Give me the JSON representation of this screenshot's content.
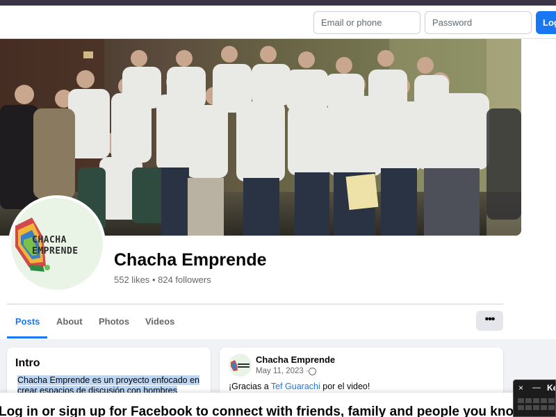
{
  "navbar": {
    "email_placeholder": "Email or phone",
    "password_placeholder": "Password",
    "login_label": "Log In"
  },
  "profile": {
    "name": "Chacha Emprende",
    "likes": "552 likes",
    "separator": "•",
    "followers": "824 followers",
    "logo_line1": "CHACHA",
    "logo_line2": "EMPRENDE"
  },
  "tabs": [
    {
      "label": "Posts",
      "active": true
    },
    {
      "label": "About"
    },
    {
      "label": "Photos"
    },
    {
      "label": "Videos"
    }
  ],
  "more_label": "•••",
  "intro": {
    "title": "Intro",
    "text": "Chacha Emprende es un proyecto enfocado en crear espacios de discusión con hombres"
  },
  "post": {
    "author": "Chacha Emprende",
    "date": "May 11, 2023 ·",
    "text_before": "¡Gracias a ",
    "mention": "Tef Guarachi",
    "text_after": " por el video!"
  },
  "banner": {
    "text": "Log in or sign up for Facebook to connect with friends, family and people you know."
  },
  "keyboard_widget": {
    "close": "×",
    "minimize": "—",
    "label": "Ke"
  },
  "icons": {
    "globe": "globe-icon",
    "more": "more-options-icon"
  },
  "colors": {
    "accent": "#1877f2",
    "background": "#f0f2f5",
    "text_secondary": "#65676b"
  }
}
